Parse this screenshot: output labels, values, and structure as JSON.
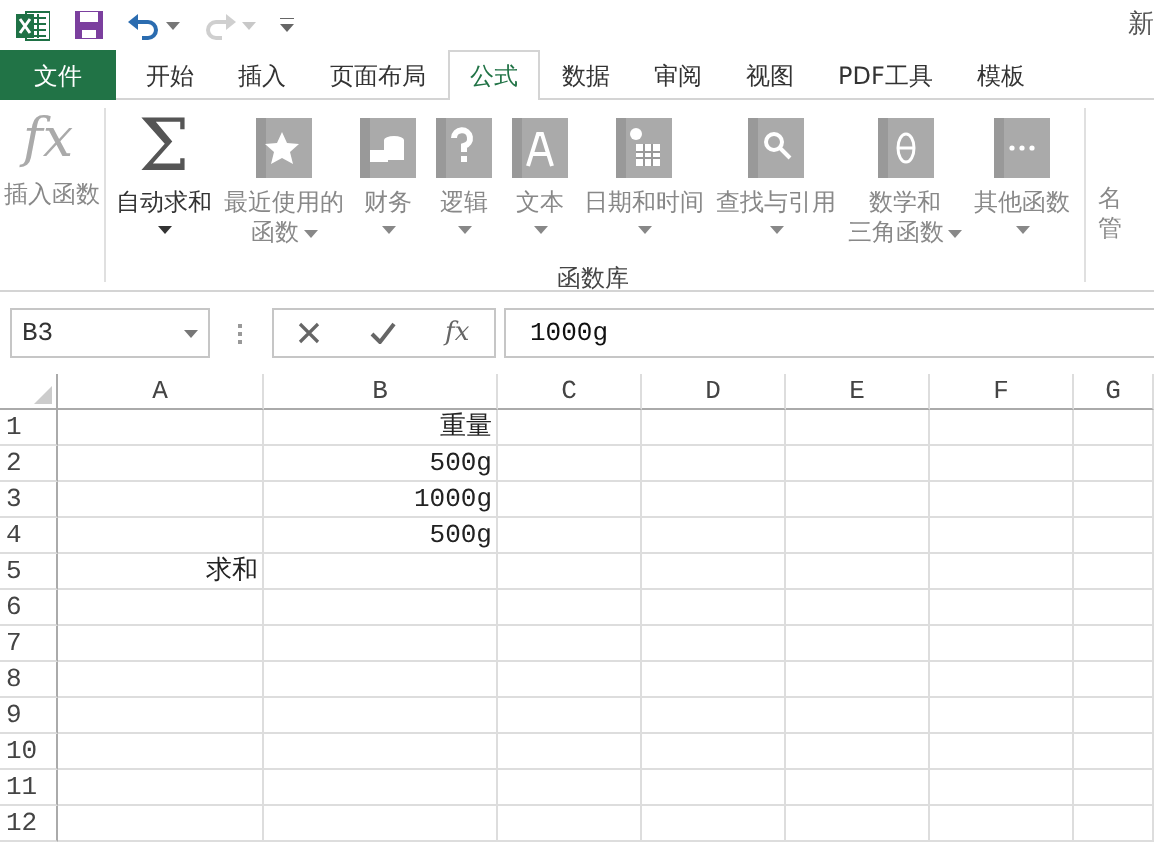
{
  "quick_access": {
    "title_fragment": "新",
    "redo_disabled": true
  },
  "tabs": [
    {
      "label": "文件",
      "kind": "file",
      "selected": false
    },
    {
      "label": "开始",
      "kind": "tab",
      "selected": false
    },
    {
      "label": "插入",
      "kind": "tab",
      "selected": false
    },
    {
      "label": "页面布局",
      "kind": "tab",
      "selected": false
    },
    {
      "label": "公式",
      "kind": "tab",
      "selected": true
    },
    {
      "label": "数据",
      "kind": "tab",
      "selected": false
    },
    {
      "label": "审阅",
      "kind": "tab",
      "selected": false
    },
    {
      "label": "视图",
      "kind": "tab",
      "selected": false
    },
    {
      "label": "PDF工具",
      "kind": "tab",
      "selected": false
    },
    {
      "label": "模板",
      "kind": "tab",
      "selected": false
    }
  ],
  "ribbon": {
    "group_label": "函数库",
    "buttons": [
      {
        "glyph": "fx",
        "lines": [
          "插入函数"
        ],
        "disabled": true,
        "dropdown": false
      },
      {
        "glyph": "Σ",
        "lines": [
          "自动求和"
        ],
        "disabled": false,
        "dropdown": true
      },
      {
        "lines": [
          "最近使用的",
          "函数"
        ],
        "disabled": true,
        "dropdown": true
      },
      {
        "lines": [
          "财务"
        ],
        "disabled": true,
        "dropdown": true
      },
      {
        "lines": [
          "逻辑"
        ],
        "disabled": true,
        "dropdown": true
      },
      {
        "lines": [
          "文本"
        ],
        "disabled": true,
        "dropdown": true
      },
      {
        "lines": [
          "日期和时间"
        ],
        "disabled": true,
        "dropdown": true
      },
      {
        "lines": [
          "查找与引用"
        ],
        "disabled": true,
        "dropdown": true
      },
      {
        "lines": [
          "数学和",
          "三角函数"
        ],
        "disabled": true,
        "dropdown": true
      },
      {
        "lines": [
          "其他函数"
        ],
        "disabled": true,
        "dropdown": true
      }
    ],
    "cut_button": {
      "lines": [
        "名",
        "管"
      ]
    }
  },
  "formula_bar": {
    "name_box": "B3",
    "function_glyph": "fx",
    "value": "1000g"
  },
  "sheet": {
    "columns": [
      "A",
      "B",
      "C",
      "D",
      "E",
      "F",
      "G"
    ],
    "rows": [
      {
        "number": "1",
        "cells": [
          "",
          "重量"
        ]
      },
      {
        "number": "2",
        "cells": [
          "",
          "500g"
        ]
      },
      {
        "number": "3",
        "cells": [
          "",
          "1000g"
        ]
      },
      {
        "number": "4",
        "cells": [
          "",
          "500g"
        ]
      },
      {
        "number": "5",
        "cells": [
          "求和",
          ""
        ]
      },
      {
        "number": "6",
        "cells": [
          "",
          ""
        ]
      },
      {
        "number": "7",
        "cells": [
          "",
          ""
        ]
      },
      {
        "number": "8",
        "cells": [
          "",
          ""
        ]
      },
      {
        "number": "9",
        "cells": [
          "",
          ""
        ]
      },
      {
        "number": "10",
        "cells": [
          "",
          ""
        ]
      },
      {
        "number": "11",
        "cells": [
          "",
          ""
        ]
      },
      {
        "number": "12",
        "cells": [
          "",
          ""
        ]
      }
    ]
  }
}
